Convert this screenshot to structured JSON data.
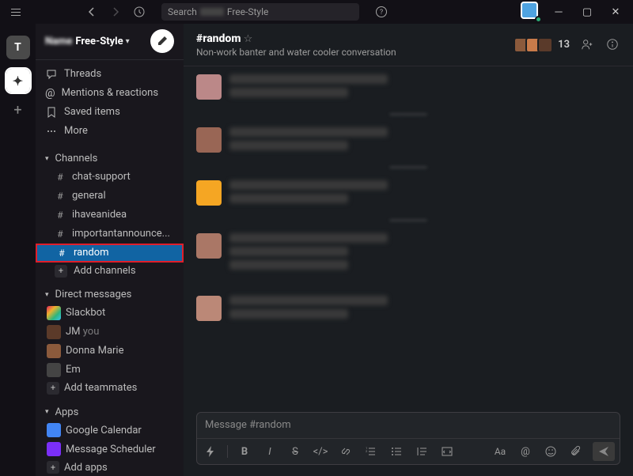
{
  "titlebar": {
    "search_prefix": "Search",
    "search_workspace": "Free-Style"
  },
  "rail": {
    "workspaces": [
      {
        "letter": "T"
      },
      {
        "letter": "✦"
      }
    ]
  },
  "sidebar": {
    "workspace_name_blur": "Name",
    "workspace_name": "Free-Style",
    "nav": [
      {
        "icon": "threads",
        "label": "Threads"
      },
      {
        "icon": "mentions",
        "label": "Mentions & reactions"
      },
      {
        "icon": "bookmark",
        "label": "Saved items"
      },
      {
        "icon": "more",
        "label": "More"
      }
    ],
    "channels_header": "Channels",
    "channels": [
      {
        "name": "chat-support",
        "selected": false
      },
      {
        "name": "general",
        "selected": false
      },
      {
        "name": "ihaveanidea",
        "selected": false
      },
      {
        "name": "importantannounce...",
        "selected": false
      },
      {
        "name": "random",
        "selected": true
      }
    ],
    "add_channels": "Add channels",
    "dm_header": "Direct messages",
    "dms": [
      {
        "name": "Slackbot",
        "color": "linear-gradient(135deg,#e01e5a,#ecb22e,#2eb67d,#36c5f0)"
      },
      {
        "name": "JM",
        "suffix": "you",
        "color": "#5b3a29"
      },
      {
        "name": "Donna Marie",
        "color": "#8b5a3c"
      },
      {
        "name": "Em",
        "color": "#444"
      }
    ],
    "add_teammates": "Add teammates",
    "apps_header": "Apps",
    "apps": [
      {
        "name": "Google Calendar",
        "color": "#4285f4"
      },
      {
        "name": "Message Scheduler",
        "color": "#7b2ff7"
      }
    ],
    "add_apps": "Add apps"
  },
  "channel": {
    "name": "#random",
    "topic": "Non-work banter and water cooler conversation",
    "member_count": "13",
    "composer_placeholder": "Message #random"
  },
  "toolbar": {
    "items": [
      "bolt",
      "bold",
      "italic",
      "strike",
      "code",
      "link",
      "ol",
      "ul",
      "quote",
      "codeblock"
    ],
    "right": [
      "Aa",
      "at",
      "emoji",
      "attach"
    ]
  }
}
